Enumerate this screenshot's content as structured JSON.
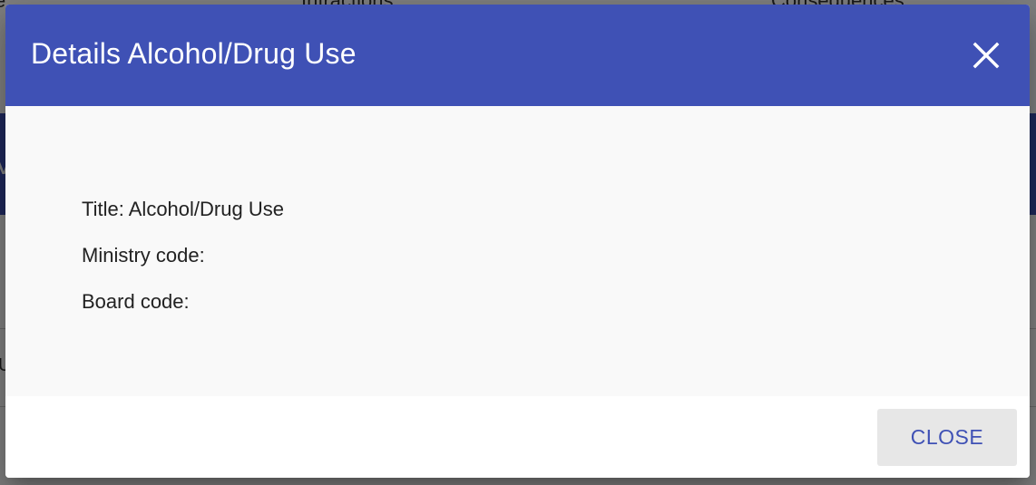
{
  "background": {
    "columns": [
      "e",
      "Infractions",
      "Consequences"
    ],
    "band_letter": "V",
    "cell_char": "U"
  },
  "dialog": {
    "title": "Details Alcohol/Drug Use",
    "close_icon": "close-icon",
    "fields": {
      "title": "Title: Alcohol/Drug Use",
      "ministry_code": "Ministry code:",
      "board_code": "Board code:"
    },
    "close_button_label": "CLOSE"
  },
  "colors": {
    "header": "#3f51b5",
    "body": "#f9f9f9",
    "button_bg": "#e7e7e7",
    "button_text": "#3f51b5"
  }
}
